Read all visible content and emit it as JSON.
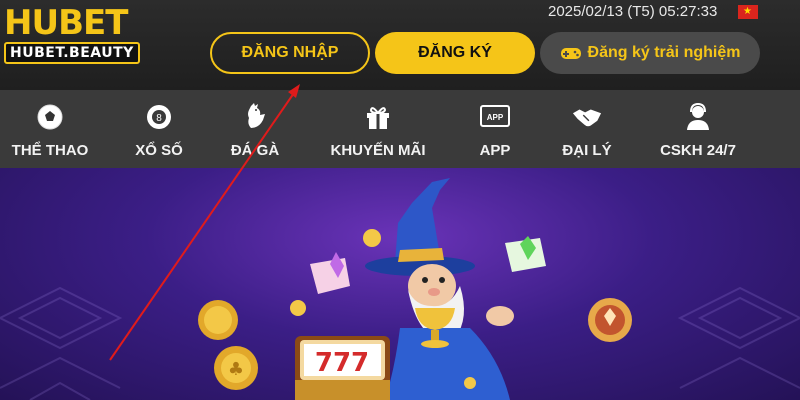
{
  "header": {
    "logo_main": "HUBET",
    "logo_sub": "HUBET.BEAUTY",
    "datetime": "2025/02/13 (T5) 05:27:33",
    "flag_icon": "vietnam-flag-icon",
    "login_label": "ĐĂNG NHẬP",
    "register_label": "ĐĂNG KÝ",
    "trial_label": "Đăng ký trải nghiệm",
    "accent_color": "#f5c518"
  },
  "nav": {
    "items": [
      {
        "label": "THỂ THAO",
        "icon": "soccer-ball-icon"
      },
      {
        "label": "XỔ SỐ",
        "icon": "lottery-ball-icon"
      },
      {
        "label": "ĐÁ GÀ",
        "icon": "rooster-icon"
      },
      {
        "label": "KHUYẾN MÃI",
        "icon": "gift-icon"
      },
      {
        "label": "APP",
        "icon": "app-icon"
      },
      {
        "label": "ĐẠI LÝ",
        "icon": "handshake-icon"
      },
      {
        "label": "CSKH 24/7",
        "icon": "support-agent-icon"
      }
    ],
    "app_icon_text": "APP"
  },
  "banner": {
    "slot_digits": "777",
    "theme_color": "#3b1e86"
  }
}
